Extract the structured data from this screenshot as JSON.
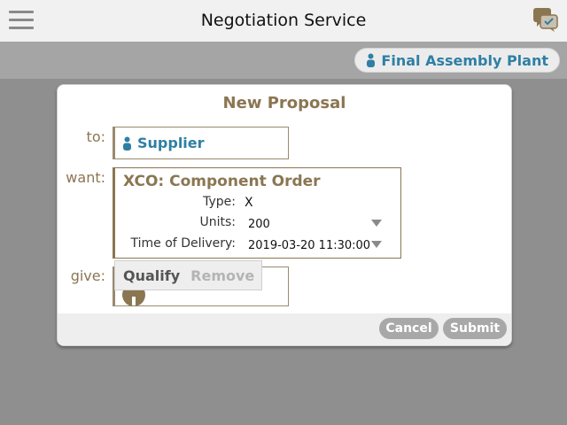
{
  "header": {
    "title": "Negotiation Service",
    "menu_icon": "hamburger-menu-icon",
    "chat_icon": "chat-bubbles-icon"
  },
  "subbar": {
    "organization": "Final Assembly Plant",
    "organization_icon": "person-icon"
  },
  "modal": {
    "title": "New Proposal",
    "to": {
      "label": "to:",
      "value": "Supplier",
      "icon": "person-icon"
    },
    "want": {
      "label": "want:",
      "title": "XCO: Component Order",
      "fields": {
        "type_label": "Type:",
        "type_value": "X",
        "units_label": "Units:",
        "units_value": "200",
        "delivery_label": "Time of Delivery:",
        "delivery_value": "2019-03-20 11:30:00"
      }
    },
    "give": {
      "label": "give:"
    },
    "popup": {
      "qualify": "Qualify",
      "remove": "Remove"
    },
    "footer": {
      "cancel": "Cancel",
      "submit": "Submit"
    }
  },
  "colors": {
    "accent_brown": "#8b7652",
    "link_blue": "#2f7fa4",
    "background_gray": "#8f8f8f",
    "button_gray": "#a8a8a8"
  }
}
